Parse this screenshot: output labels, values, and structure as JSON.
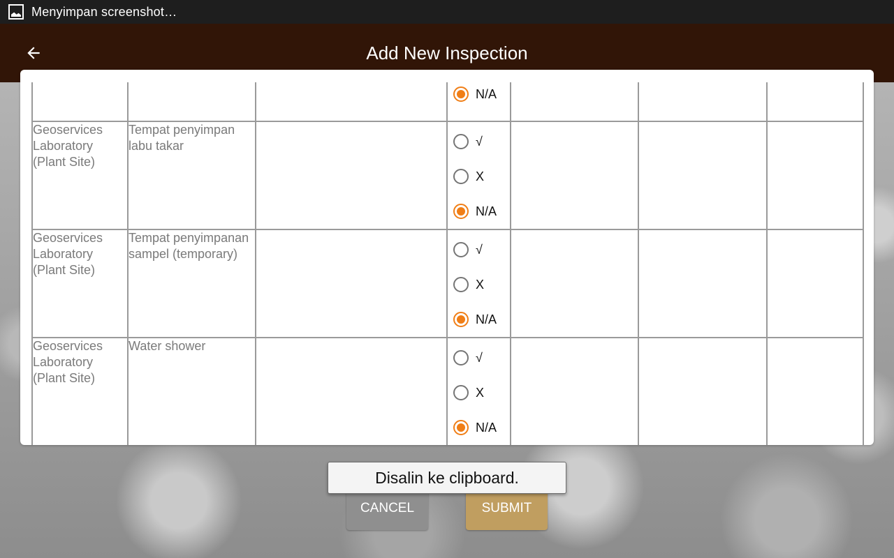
{
  "status_bar": {
    "icon": "image-icon",
    "text": "Menyimpan screenshot…"
  },
  "toolbar": {
    "back_icon": "arrow-back-icon",
    "title": "Add New Inspection"
  },
  "colors": {
    "toolbar_bg": "#311507",
    "radio_accent": "#f07e16",
    "submit_bg": "#c09e60",
    "cancel_bg": "#8f8f8f"
  },
  "table": {
    "partial_row": {
      "options": [
        {
          "label": "N/A",
          "checked": true
        }
      ]
    },
    "rows": [
      {
        "location": "Geoservices Laboratory (Plant Site)",
        "item": "Tempat penyimpan labu takar",
        "options": [
          {
            "label": "√",
            "checked": false
          },
          {
            "label": "X",
            "checked": false
          },
          {
            "label": "N/A",
            "checked": true
          }
        ]
      },
      {
        "location": "Geoservices Laboratory (Plant Site)",
        "item": "Tempat penyimpanan sampel (temporary)",
        "options": [
          {
            "label": "√",
            "checked": false
          },
          {
            "label": "X",
            "checked": false
          },
          {
            "label": "N/A",
            "checked": true
          }
        ]
      },
      {
        "location": "Geoservices Laboratory (Plant Site)",
        "item": "Water shower",
        "options": [
          {
            "label": "√",
            "checked": false
          },
          {
            "label": "X",
            "checked": false
          },
          {
            "label": "N/A",
            "checked": true
          }
        ]
      }
    ]
  },
  "buttons": {
    "cancel_label": "CANCEL",
    "submit_label": "SUBMIT"
  },
  "toast": {
    "text": "Disalin ke clipboard."
  }
}
